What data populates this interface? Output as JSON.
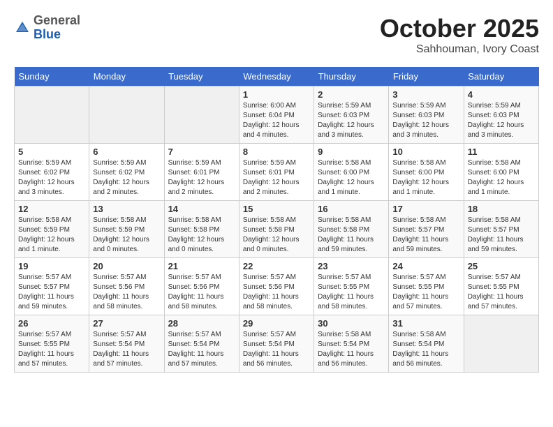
{
  "header": {
    "logo_general": "General",
    "logo_blue": "Blue",
    "month": "October 2025",
    "location": "Sahhouman, Ivory Coast"
  },
  "days_of_week": [
    "Sunday",
    "Monday",
    "Tuesday",
    "Wednesday",
    "Thursday",
    "Friday",
    "Saturday"
  ],
  "weeks": [
    [
      {
        "day": "",
        "info": ""
      },
      {
        "day": "",
        "info": ""
      },
      {
        "day": "",
        "info": ""
      },
      {
        "day": "1",
        "info": "Sunrise: 6:00 AM\nSunset: 6:04 PM\nDaylight: 12 hours\nand 4 minutes."
      },
      {
        "day": "2",
        "info": "Sunrise: 5:59 AM\nSunset: 6:03 PM\nDaylight: 12 hours\nand 3 minutes."
      },
      {
        "day": "3",
        "info": "Sunrise: 5:59 AM\nSunset: 6:03 PM\nDaylight: 12 hours\nand 3 minutes."
      },
      {
        "day": "4",
        "info": "Sunrise: 5:59 AM\nSunset: 6:03 PM\nDaylight: 12 hours\nand 3 minutes."
      }
    ],
    [
      {
        "day": "5",
        "info": "Sunrise: 5:59 AM\nSunset: 6:02 PM\nDaylight: 12 hours\nand 3 minutes."
      },
      {
        "day": "6",
        "info": "Sunrise: 5:59 AM\nSunset: 6:02 PM\nDaylight: 12 hours\nand 2 minutes."
      },
      {
        "day": "7",
        "info": "Sunrise: 5:59 AM\nSunset: 6:01 PM\nDaylight: 12 hours\nand 2 minutes."
      },
      {
        "day": "8",
        "info": "Sunrise: 5:59 AM\nSunset: 6:01 PM\nDaylight: 12 hours\nand 2 minutes."
      },
      {
        "day": "9",
        "info": "Sunrise: 5:58 AM\nSunset: 6:00 PM\nDaylight: 12 hours\nand 1 minute."
      },
      {
        "day": "10",
        "info": "Sunrise: 5:58 AM\nSunset: 6:00 PM\nDaylight: 12 hours\nand 1 minute."
      },
      {
        "day": "11",
        "info": "Sunrise: 5:58 AM\nSunset: 6:00 PM\nDaylight: 12 hours\nand 1 minute."
      }
    ],
    [
      {
        "day": "12",
        "info": "Sunrise: 5:58 AM\nSunset: 5:59 PM\nDaylight: 12 hours\nand 1 minute."
      },
      {
        "day": "13",
        "info": "Sunrise: 5:58 AM\nSunset: 5:59 PM\nDaylight: 12 hours\nand 0 minutes."
      },
      {
        "day": "14",
        "info": "Sunrise: 5:58 AM\nSunset: 5:58 PM\nDaylight: 12 hours\nand 0 minutes."
      },
      {
        "day": "15",
        "info": "Sunrise: 5:58 AM\nSunset: 5:58 PM\nDaylight: 12 hours\nand 0 minutes."
      },
      {
        "day": "16",
        "info": "Sunrise: 5:58 AM\nSunset: 5:58 PM\nDaylight: 11 hours\nand 59 minutes."
      },
      {
        "day": "17",
        "info": "Sunrise: 5:58 AM\nSunset: 5:57 PM\nDaylight: 11 hours\nand 59 minutes."
      },
      {
        "day": "18",
        "info": "Sunrise: 5:58 AM\nSunset: 5:57 PM\nDaylight: 11 hours\nand 59 minutes."
      }
    ],
    [
      {
        "day": "19",
        "info": "Sunrise: 5:57 AM\nSunset: 5:57 PM\nDaylight: 11 hours\nand 59 minutes."
      },
      {
        "day": "20",
        "info": "Sunrise: 5:57 AM\nSunset: 5:56 PM\nDaylight: 11 hours\nand 58 minutes."
      },
      {
        "day": "21",
        "info": "Sunrise: 5:57 AM\nSunset: 5:56 PM\nDaylight: 11 hours\nand 58 minutes."
      },
      {
        "day": "22",
        "info": "Sunrise: 5:57 AM\nSunset: 5:56 PM\nDaylight: 11 hours\nand 58 minutes."
      },
      {
        "day": "23",
        "info": "Sunrise: 5:57 AM\nSunset: 5:55 PM\nDaylight: 11 hours\nand 58 minutes."
      },
      {
        "day": "24",
        "info": "Sunrise: 5:57 AM\nSunset: 5:55 PM\nDaylight: 11 hours\nand 57 minutes."
      },
      {
        "day": "25",
        "info": "Sunrise: 5:57 AM\nSunset: 5:55 PM\nDaylight: 11 hours\nand 57 minutes."
      }
    ],
    [
      {
        "day": "26",
        "info": "Sunrise: 5:57 AM\nSunset: 5:55 PM\nDaylight: 11 hours\nand 57 minutes."
      },
      {
        "day": "27",
        "info": "Sunrise: 5:57 AM\nSunset: 5:54 PM\nDaylight: 11 hours\nand 57 minutes."
      },
      {
        "day": "28",
        "info": "Sunrise: 5:57 AM\nSunset: 5:54 PM\nDaylight: 11 hours\nand 57 minutes."
      },
      {
        "day": "29",
        "info": "Sunrise: 5:57 AM\nSunset: 5:54 PM\nDaylight: 11 hours\nand 56 minutes."
      },
      {
        "day": "30",
        "info": "Sunrise: 5:58 AM\nSunset: 5:54 PM\nDaylight: 11 hours\nand 56 minutes."
      },
      {
        "day": "31",
        "info": "Sunrise: 5:58 AM\nSunset: 5:54 PM\nDaylight: 11 hours\nand 56 minutes."
      },
      {
        "day": "",
        "info": ""
      }
    ]
  ]
}
